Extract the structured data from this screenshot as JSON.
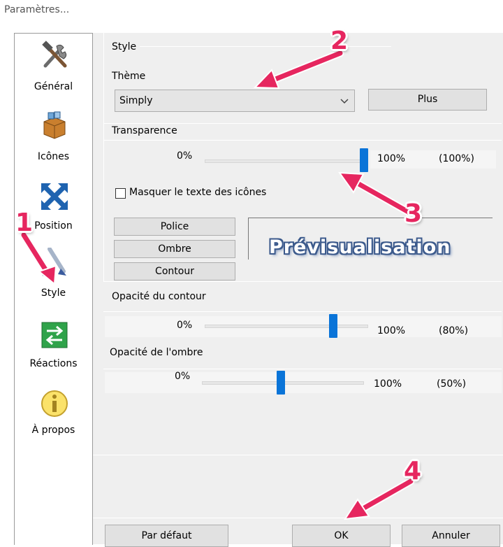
{
  "window": {
    "title": "Paramètres..."
  },
  "sidebar": {
    "items": [
      {
        "label": "Général",
        "icon": "tools-icon"
      },
      {
        "label": "Icônes",
        "icon": "box-icon"
      },
      {
        "label": "Position",
        "icon": "arrows-icon"
      },
      {
        "label": "Style",
        "icon": "brush-icon"
      },
      {
        "label": "Réactions",
        "icon": "exchange-icon"
      },
      {
        "label": "À propos",
        "icon": "info-icon"
      }
    ]
  },
  "style_section": {
    "title": "Style",
    "theme_label": "Thème",
    "theme_value": "Simply",
    "more_button": "Plus"
  },
  "transparency": {
    "label": "Transparence",
    "min": "0%",
    "max": "100%",
    "current": "(100%)",
    "value_percent": 100
  },
  "hide_text_checkbox": {
    "label": "Masquer le texte des icônes",
    "checked": false
  },
  "font_buttons": {
    "font": "Police",
    "shadow": "Ombre",
    "outline": "Contour"
  },
  "preview": {
    "text": "Prévisualisation"
  },
  "outline_opacity": {
    "label": "Opacité du contour",
    "min": "0%",
    "max": "100%",
    "current": "(80%)",
    "value_percent": 80
  },
  "shadow_opacity": {
    "label": "Opacité de l'ombre",
    "min": "0%",
    "max": "100%",
    "current": "(50%)",
    "value_percent": 50
  },
  "footer": {
    "default_button": "Par défaut",
    "ok_button": "OK",
    "cancel_button": "Annuler"
  },
  "annotations": {
    "badge_1": "1",
    "badge_2": "2",
    "badge_3": "3",
    "badge_4": "4"
  },
  "colors": {
    "accent": "#0a74d8",
    "annotation": "#e6265f"
  }
}
